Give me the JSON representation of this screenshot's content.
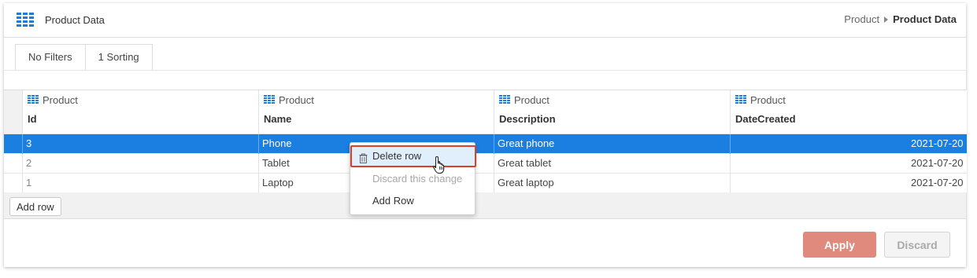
{
  "header": {
    "title": "Product Data",
    "breadcrumb": {
      "parent": "Product",
      "current": "Product Data"
    }
  },
  "tabs": [
    {
      "label": "No Filters"
    },
    {
      "label": "1 Sorting"
    }
  ],
  "table": {
    "columns": [
      {
        "source": "Product",
        "name": "Id"
      },
      {
        "source": "Product",
        "name": "Name"
      },
      {
        "source": "Product",
        "name": "Description"
      },
      {
        "source": "Product",
        "name": "DateCreated"
      }
    ],
    "rows": [
      {
        "id": "3",
        "name": "Phone",
        "description": "Great phone",
        "date": "2021-07-20",
        "selected": true
      },
      {
        "id": "2",
        "name": "Tablet",
        "description": "Great tablet",
        "date": "2021-07-20",
        "selected": false
      },
      {
        "id": "1",
        "name": "Laptop",
        "description": "Great laptop",
        "date": "2021-07-20",
        "selected": false
      }
    ]
  },
  "add_row_label": "Add row",
  "context_menu": {
    "delete": "Delete row",
    "discard": "Discard this change",
    "add": "Add Row"
  },
  "footer": {
    "apply": "Apply",
    "discard": "Discard"
  },
  "colors": {
    "selection": "#1a7fe0",
    "apply_button": "#e08a7d",
    "icon_blue": "#1a7fe0",
    "highlight_border": "#d9412b"
  },
  "icons": {
    "header": "table-grid-icon",
    "column": "table-grid-icon",
    "delete": "trash-icon",
    "cursor": "hand-pointer-icon"
  }
}
